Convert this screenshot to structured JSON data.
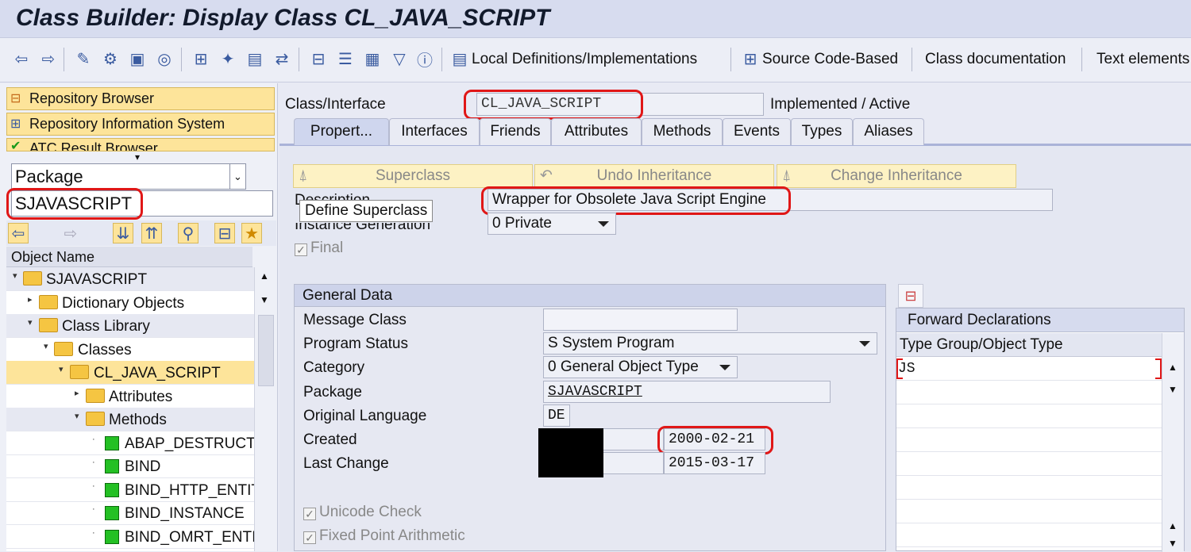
{
  "window_title": "Class Builder: Display Class CL_JAVA_SCRIPT",
  "toolbar": {
    "local_defs": "Local Definitions/Implementations",
    "source_code": "Source Code-Based",
    "class_doc": "Class documentation",
    "text_elements": "Text elements"
  },
  "left": {
    "repo_browser": "Repository Browser",
    "repo_info": "Repository Information System",
    "atc": "ATC Result Browser",
    "object_type": "Package",
    "object_value": "SJAVASCRIPT",
    "column_header": "Object Name",
    "tree": [
      {
        "label": "SJAVASCRIPT"
      },
      {
        "label": "Dictionary Objects"
      },
      {
        "label": "Class Library"
      },
      {
        "label": "Classes"
      },
      {
        "label": "CL_JAVA_SCRIPT"
      },
      {
        "label": "Attributes"
      },
      {
        "label": "Methods"
      },
      {
        "label": "ABAP_DESTRUCTC"
      },
      {
        "label": "BIND"
      },
      {
        "label": "BIND_HTTP_ENTIT"
      },
      {
        "label": "BIND_INSTANCE"
      },
      {
        "label": "BIND_OMRT_ENTI"
      }
    ]
  },
  "main": {
    "class_label": "Class/Interface",
    "class_value": "CL_JAVA_SCRIPT",
    "status": "Implemented / Active",
    "tabs": [
      "Propert...",
      "Interfaces",
      "Friends",
      "Attributes",
      "Methods",
      "Events",
      "Types",
      "Aliases"
    ],
    "superclass_btn": "Superclass",
    "undo_btn": "Undo Inheritance",
    "change_btn": "Change Inheritance",
    "description_label": "Description",
    "description_value": "Wrapper for Obsolete Java Script Engine",
    "tooltip": "Define Superclass",
    "inst_gen_label": "Instance Generation",
    "inst_gen_value": "0 Private",
    "final_label": "Final",
    "general_data": {
      "header": "General Data",
      "message_class_label": "Message Class",
      "message_class_value": "",
      "program_status_label": "Program Status",
      "program_status_value": "S System Program",
      "category_label": "Category",
      "category_value": "0 General Object Type",
      "package_label": "Package",
      "package_value": "SJAVASCRIPT",
      "orig_lang_label": "Original Language",
      "orig_lang_value": "DE",
      "created_label": "Created",
      "created_date": "2000-02-21",
      "last_change_label": "Last Change",
      "last_change_date": "2015-03-17",
      "unicode_label": "Unicode Check",
      "fixed_point_label": "Fixed Point Arithmetic"
    },
    "forward": {
      "header": "Forward Declarations",
      "col_header": "Type Group/Object Type",
      "rows": [
        "JS"
      ]
    }
  }
}
